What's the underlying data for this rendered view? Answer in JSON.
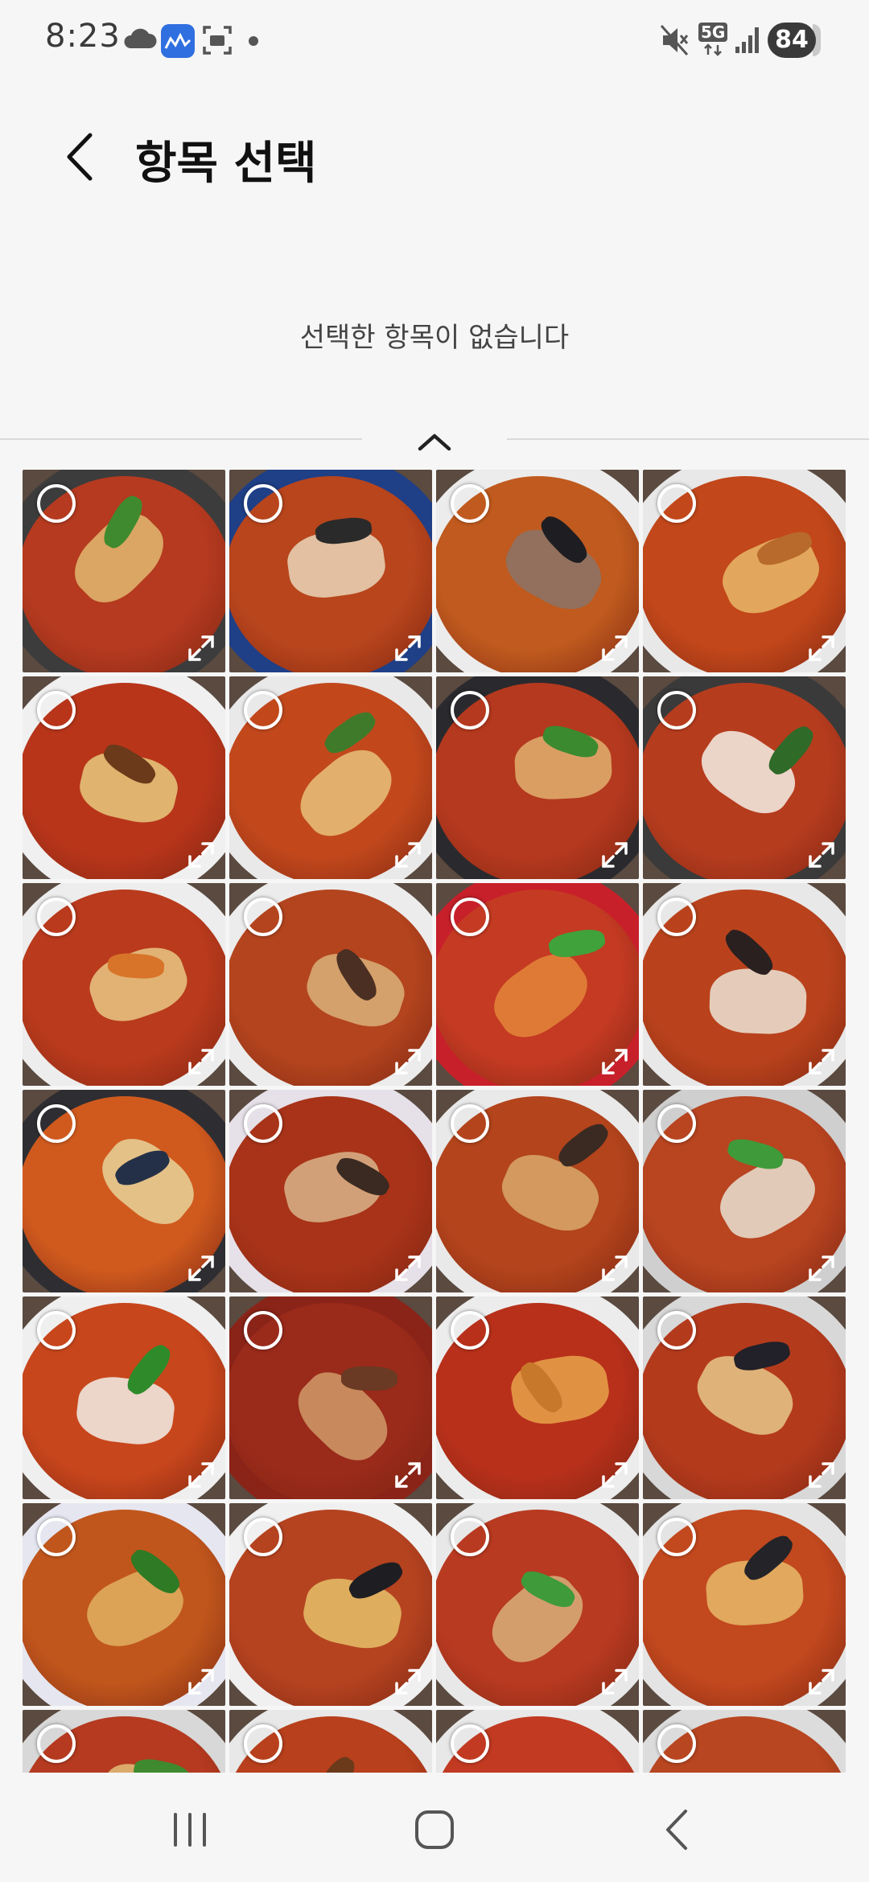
{
  "status_bar": {
    "time": "8:23",
    "network": "5G",
    "battery": "84",
    "left_icons": [
      "cloud-icon",
      "app-notification-icon",
      "screenshot-icon",
      "dot-icon"
    ],
    "right_icons": [
      "mute-icon",
      "network-5g-icon",
      "signal-icon",
      "battery-icon"
    ]
  },
  "header": {
    "title": "항목 선택",
    "back_icon": "chevron-left-icon"
  },
  "selection": {
    "empty_message": "선택한 항목이 없습니다"
  },
  "colors": {
    "background": "#f6f6f6",
    "text_primary": "#111111",
    "text_secondary": "#444444"
  },
  "gallery": {
    "columns": 4,
    "items": [
      {
        "soup": "#b53a1f",
        "plate": "#3c3c3c",
        "noodle": "#e2b870",
        "garnish": "#3f8a2e",
        "selected": false
      },
      {
        "soup": "#b8451c",
        "plate": "#1f3f86",
        "noodle": "#e9d6b8",
        "garnish": "#2a2a2a",
        "selected": false
      },
      {
        "soup": "#c05a1e",
        "plate": "#ececec",
        "noodle": "#8a7468",
        "garnish": "#1e1e22",
        "selected": false
      },
      {
        "soup": "#c2471a",
        "plate": "#e8e8e8",
        "noodle": "#e7b96a",
        "garnish": "#b86a2c",
        "selected": false
      },
      {
        "soup": "#b8351a",
        "plate": "#f0f0f0",
        "noodle": "#e6c97e",
        "garnish": "#6b3a1a",
        "selected": false
      },
      {
        "soup": "#c2481c",
        "plate": "#e9e9e9",
        "noodle": "#e8c27a",
        "garnish": "#3f7a2a",
        "selected": false
      },
      {
        "soup": "#b5391e",
        "plate": "#2a2a2e",
        "noodle": "#e0b070",
        "garnish": "#3b8a2f",
        "selected": false
      },
      {
        "soup": "#b63c1e",
        "plate": "#3a3a3a",
        "noodle": "#f4efe6",
        "garnish": "#2f6a28",
        "selected": false
      },
      {
        "soup": "#b93a1c",
        "plate": "#ededed",
        "noodle": "#e8c882",
        "garnish": "#d8742a",
        "selected": false
      },
      {
        "soup": "#b3441e",
        "plate": "#ececec",
        "noodle": "#d9b079",
        "garnish": "#4a2f22",
        "selected": false
      },
      {
        "soup": "#c43a22",
        "plate": "#c8202a",
        "noodle": "#e4863a",
        "garnish": "#3fa23a",
        "selected": false
      },
      {
        "soup": "#b9421c",
        "plate": "#e8e8e8",
        "noodle": "#ece4d6",
        "garnish": "#2a2020",
        "selected": false
      },
      {
        "soup": "#d05a1e",
        "plate": "#2e2e32",
        "noodle": "#e8d49a",
        "garnish": "#243048",
        "selected": false
      },
      {
        "soup": "#a83318",
        "plate": "#e6e0e8",
        "noodle": "#d9b48a",
        "garnish": "#3a2a22",
        "selected": false
      },
      {
        "soup": "#b3441c",
        "plate": "#e9e9e9",
        "noodle": "#d8a86a",
        "garnish": "#3a2a22",
        "selected": false
      },
      {
        "soup": "#b84420",
        "plate": "#cfcfcf",
        "noodle": "#e8e2d2",
        "garnish": "#3f9a3a",
        "selected": false
      },
      {
        "soup": "#c8461c",
        "plate": "#efefef",
        "noodle": "#f2efe8",
        "garnish": "#2f8a2a",
        "selected": false
      },
      {
        "soup": "#9a2a1a",
        "plate": "#8a2418",
        "noodle": "#d09a6a",
        "garnish": "#6a3a24",
        "selected": false
      },
      {
        "soup": "#b8301a",
        "plate": "#ececec",
        "noodle": "#e8a24a",
        "garnish": "#c8782a",
        "selected": false
      },
      {
        "soup": "#b43a1c",
        "plate": "#d8d8d8",
        "noodle": "#e6c88a",
        "garnish": "#222028",
        "selected": false
      },
      {
        "soup": "#c0561c",
        "plate": "#e6e6f0",
        "noodle": "#e0b060",
        "garnish": "#2f7a24",
        "selected": false
      },
      {
        "soup": "#b54320",
        "plate": "#f0f0f0",
        "noodle": "#e6c06a",
        "garnish": "#1e1e22",
        "selected": false
      },
      {
        "soup": "#b83a20",
        "plate": "#e8e8e8",
        "noodle": "#d8b07a",
        "garnish": "#3f9a3a",
        "selected": false
      },
      {
        "soup": "#c2481e",
        "plate": "#e4e4e4",
        "noodle": "#e6ba6a",
        "garnish": "#242428",
        "selected": false
      },
      {
        "soup": "#b53a20",
        "plate": "#d8d8d8",
        "noodle": "#e2c07a",
        "garnish": "#3f8a2e",
        "selected": false
      },
      {
        "soup": "#b8401c",
        "plate": "#e8e8e8",
        "noodle": "#e4c48a",
        "garnish": "#6a3a1a",
        "selected": false
      },
      {
        "soup": "#c23a22",
        "plate": "#e8e8e8",
        "noodle": "#d8a86a",
        "garnish": "#3fa23a",
        "selected": false
      },
      {
        "soup": "#b84620",
        "plate": "#dcdcdc",
        "noodle": "#e6c88a",
        "garnish": "#2f7a24",
        "selected": false
      }
    ]
  },
  "nav_bar": {
    "recents_icon": "recents-icon",
    "home_icon": "home-icon",
    "back_icon": "back-icon"
  }
}
